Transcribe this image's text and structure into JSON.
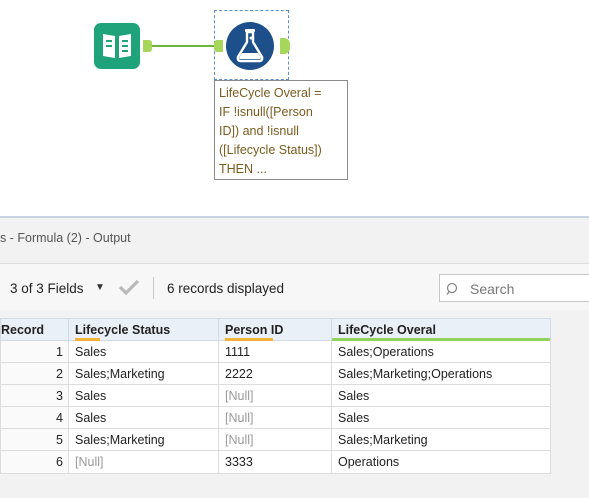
{
  "canvas": {
    "annotation_text": "LifeCycle Overal =\nIF !isnull([Person\nID]) and !isnull\n([Lifecycle Status])\nTHEN ...",
    "colors": {
      "input_tool": "#1fa37a",
      "formula_tool": "#1d4f8a",
      "anchor": "#a6d65a",
      "connection": "#6bb53a"
    }
  },
  "results": {
    "title": "s - Formula (2) - Output",
    "fields_label": "3 of 3 Fields",
    "records_label": "6 records displayed",
    "search_placeholder": "Search",
    "columns": [
      {
        "label": "Record",
        "underline": ""
      },
      {
        "label": "Lifecycle Status",
        "underline": "#f4b23b"
      },
      {
        "label": "Person ID",
        "underline": "#f4b23b"
      },
      {
        "label": "LifeCycle Overal",
        "underline": "#8fd35e"
      }
    ],
    "rows": [
      [
        "1",
        "Sales",
        "1111",
        "Sales;Operations"
      ],
      [
        "2",
        "Sales;Marketing",
        "2222",
        "Sales;Marketing;Operations"
      ],
      [
        "3",
        "Sales",
        "[Null]",
        "Sales"
      ],
      [
        "4",
        "Sales",
        "[Null]",
        "Sales"
      ],
      [
        "5",
        "Sales;Marketing",
        "[Null]",
        "Sales;Marketing"
      ],
      [
        "6",
        "[Null]",
        "3333",
        "Operations"
      ]
    ]
  }
}
